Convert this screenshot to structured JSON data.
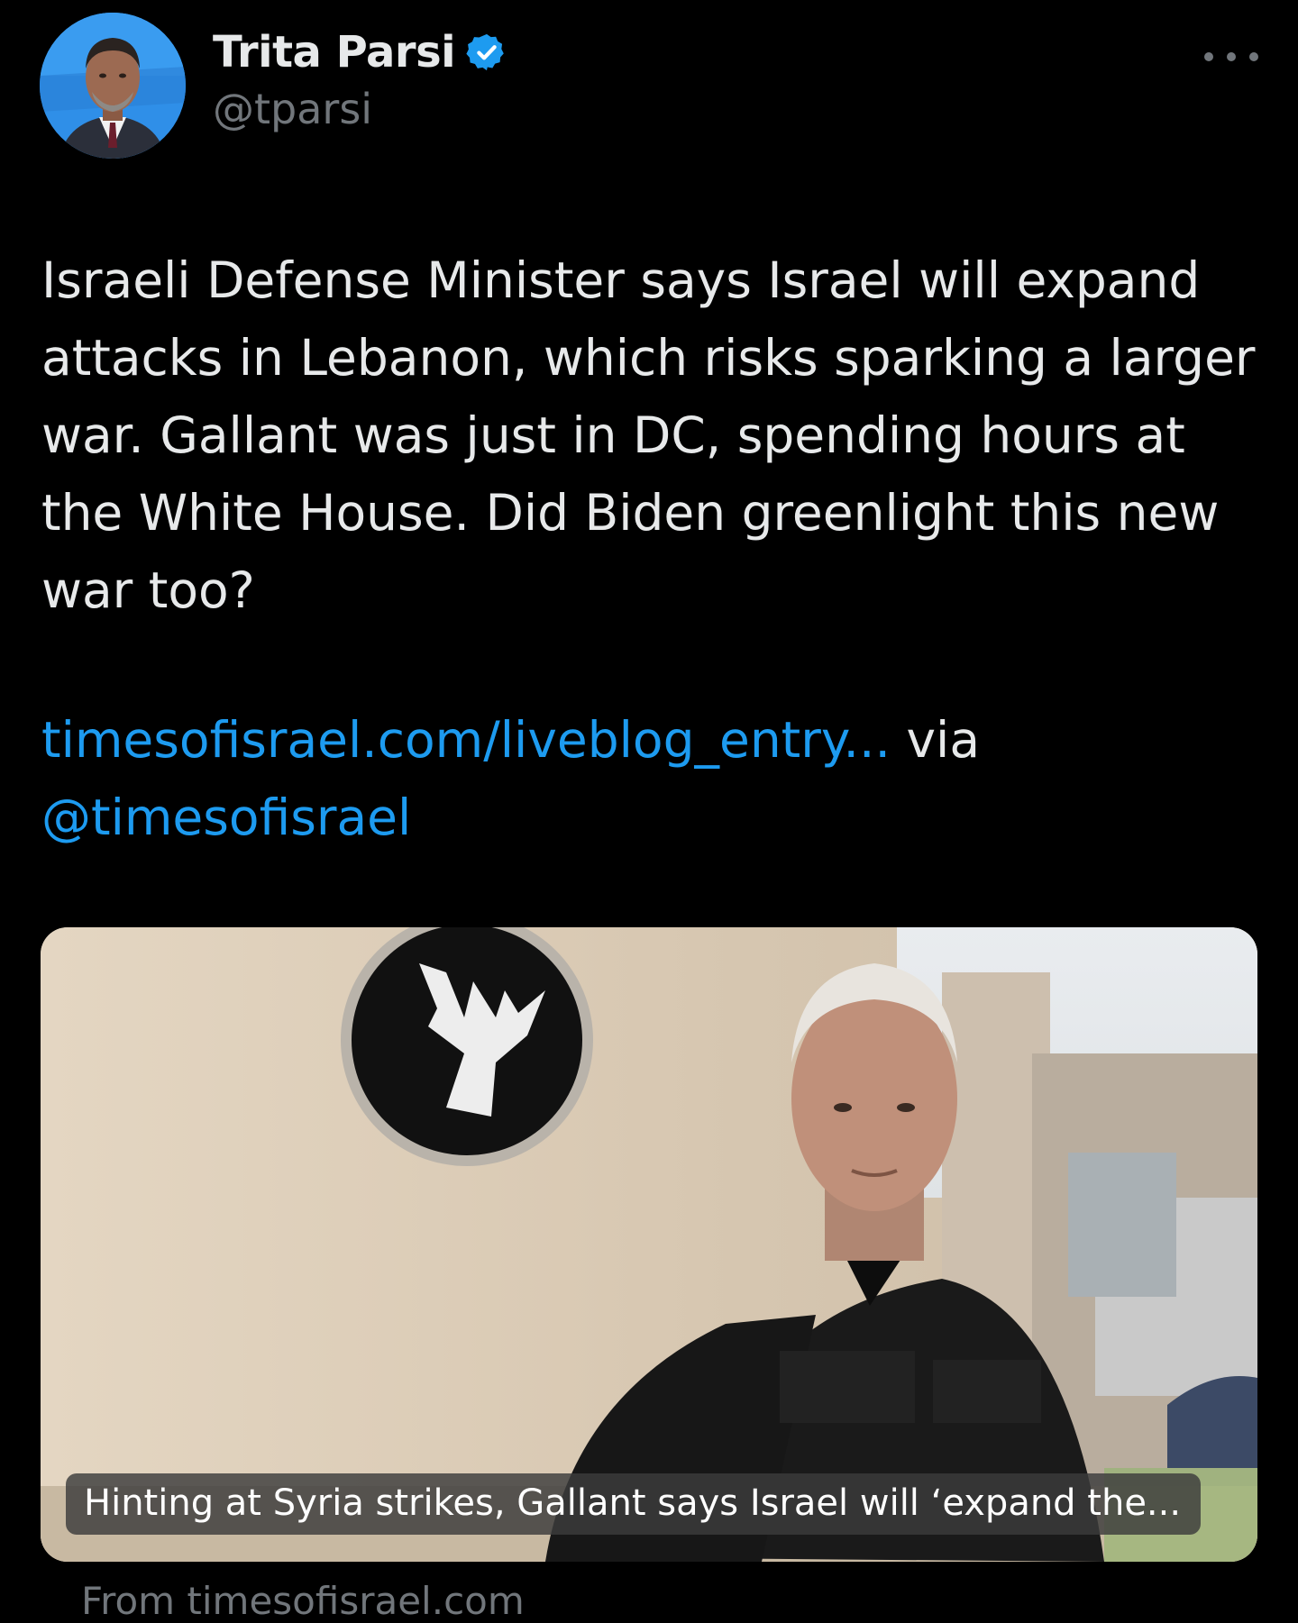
{
  "author": {
    "display_name": "Trita Parsi",
    "handle": "@tparsi",
    "verified": true
  },
  "icons": {
    "avatar": "user-photo-avatar",
    "verified": "verified-badge-icon",
    "more": "more-options-icon"
  },
  "tweet": {
    "text": "Israeli Defense Minister says Israel will expand\nattacks in Lebanon, which risks sparking a larger\nwar. Gallant was just in DC, spending hours at\nthe White House. Did Biden greenlight this new\nwar too?",
    "link_text": "timesofisrael.com/liveblog_entry...",
    "via_text": "via",
    "mention": "@timesofisrael"
  },
  "card": {
    "caption": "Hinting at Syria strikes, Gallant says Israel will ‘expand the...",
    "source": "From timesofisrael.com"
  },
  "colors": {
    "background": "#000000",
    "text": "#e7e9ea",
    "secondary": "#71767b",
    "link": "#1d9bf0",
    "verified": "#1d9bf0"
  }
}
